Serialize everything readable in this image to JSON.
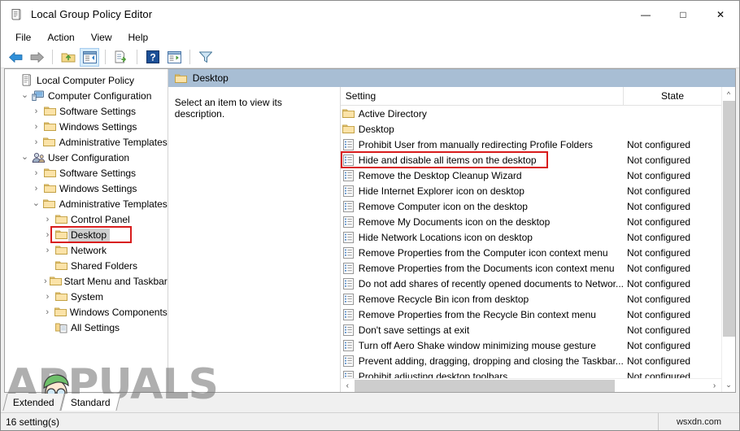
{
  "window": {
    "title": "Local Group Policy Editor",
    "icon": "policy-editor-icon",
    "minimize": "—",
    "maximize": "□",
    "close": "✕"
  },
  "menubar": {
    "items": [
      {
        "label": "File",
        "name": "menu-file"
      },
      {
        "label": "Action",
        "name": "menu-action"
      },
      {
        "label": "View",
        "name": "menu-view"
      },
      {
        "label": "Help",
        "name": "menu-help"
      }
    ]
  },
  "toolbar": {
    "buttons": [
      {
        "name": "back-icon"
      },
      {
        "name": "forward-icon"
      },
      {
        "name": "up-folder-icon"
      },
      {
        "name": "show-hide-console-tree-icon"
      },
      {
        "name": "export-list-icon"
      },
      {
        "name": "help-icon"
      },
      {
        "name": "show-hide-action-pane-icon"
      },
      {
        "name": "filter-icon"
      }
    ]
  },
  "tree": {
    "items": [
      {
        "label": "Local Computer Policy",
        "indent": 0,
        "twist": "",
        "icon": "policy-doc-icon",
        "selected": false
      },
      {
        "label": "Computer Configuration",
        "indent": 1,
        "twist": "⌄",
        "icon": "computer-icon",
        "selected": false
      },
      {
        "label": "Software Settings",
        "indent": 2,
        "twist": "›",
        "icon": "folder-icon",
        "selected": false
      },
      {
        "label": "Windows Settings",
        "indent": 2,
        "twist": "›",
        "icon": "folder-icon",
        "selected": false
      },
      {
        "label": "Administrative Templates",
        "indent": 2,
        "twist": "›",
        "icon": "folder-icon",
        "selected": false
      },
      {
        "label": "User Configuration",
        "indent": 1,
        "twist": "⌄",
        "icon": "user-icon",
        "selected": false
      },
      {
        "label": "Software Settings",
        "indent": 2,
        "twist": "›",
        "icon": "folder-icon",
        "selected": false
      },
      {
        "label": "Windows Settings",
        "indent": 2,
        "twist": "›",
        "icon": "folder-icon",
        "selected": false
      },
      {
        "label": "Administrative Templates",
        "indent": 2,
        "twist": "⌄",
        "icon": "folder-icon",
        "selected": false
      },
      {
        "label": "Control Panel",
        "indent": 3,
        "twist": "›",
        "icon": "folder-icon",
        "selected": false
      },
      {
        "label": "Desktop",
        "indent": 3,
        "twist": "›",
        "icon": "folder-icon",
        "selected": true
      },
      {
        "label": "Network",
        "indent": 3,
        "twist": "›",
        "icon": "folder-icon",
        "selected": false
      },
      {
        "label": "Shared Folders",
        "indent": 3,
        "twist": "",
        "icon": "folder-icon",
        "selected": false
      },
      {
        "label": "Start Menu and Taskbar",
        "indent": 3,
        "twist": "›",
        "icon": "folder-icon",
        "selected": false
      },
      {
        "label": "System",
        "indent": 3,
        "twist": "›",
        "icon": "folder-icon",
        "selected": false
      },
      {
        "label": "Windows Components",
        "indent": 3,
        "twist": "›",
        "icon": "folder-icon",
        "selected": false
      },
      {
        "label": "All Settings",
        "indent": 3,
        "twist": "",
        "icon": "all-settings-icon",
        "selected": false
      }
    ]
  },
  "rightpane": {
    "header_title": "Desktop",
    "header_icon": "folder-icon",
    "description": "Select an item to view its description.",
    "columns": {
      "setting": "Setting",
      "state": "State"
    },
    "rows": [
      {
        "name": "Active Directory",
        "state": "",
        "icon": "folder-icon",
        "highlighted": false
      },
      {
        "name": "Desktop",
        "state": "",
        "icon": "folder-icon",
        "highlighted": false
      },
      {
        "name": "Prohibit User from manually redirecting Profile Folders",
        "state": "Not configured",
        "icon": "policy-setting-icon",
        "highlighted": false
      },
      {
        "name": "Hide and disable all items on the desktop",
        "state": "Not configured",
        "icon": "policy-setting-icon",
        "highlighted": true
      },
      {
        "name": "Remove the Desktop Cleanup Wizard",
        "state": "Not configured",
        "icon": "policy-setting-icon",
        "highlighted": false
      },
      {
        "name": "Hide Internet Explorer icon on desktop",
        "state": "Not configured",
        "icon": "policy-setting-icon",
        "highlighted": false
      },
      {
        "name": "Remove Computer icon on the desktop",
        "state": "Not configured",
        "icon": "policy-setting-icon",
        "highlighted": false
      },
      {
        "name": "Remove My Documents icon on the desktop",
        "state": "Not configured",
        "icon": "policy-setting-icon",
        "highlighted": false
      },
      {
        "name": "Hide Network Locations icon on desktop",
        "state": "Not configured",
        "icon": "policy-setting-icon",
        "highlighted": false
      },
      {
        "name": "Remove Properties from the Computer icon context menu",
        "state": "Not configured",
        "icon": "policy-setting-icon",
        "highlighted": false
      },
      {
        "name": "Remove Properties from the Documents icon context menu",
        "state": "Not configured",
        "icon": "policy-setting-icon",
        "highlighted": false
      },
      {
        "name": "Do not add shares of recently opened documents to Networ...",
        "state": "Not configured",
        "icon": "policy-setting-icon",
        "highlighted": false
      },
      {
        "name": "Remove Recycle Bin icon from desktop",
        "state": "Not configured",
        "icon": "policy-setting-icon",
        "highlighted": false
      },
      {
        "name": "Remove Properties from the Recycle Bin context menu",
        "state": "Not configured",
        "icon": "policy-setting-icon",
        "highlighted": false
      },
      {
        "name": "Don't save settings at exit",
        "state": "Not configured",
        "icon": "policy-setting-icon",
        "highlighted": false
      },
      {
        "name": "Turn off Aero Shake window minimizing mouse gesture",
        "state": "Not configured",
        "icon": "policy-setting-icon",
        "highlighted": false
      },
      {
        "name": "Prevent adding, dragging, dropping and closing the Taskbar...",
        "state": "Not configured",
        "icon": "policy-setting-icon",
        "highlighted": false
      },
      {
        "name": "Prohibit adjusting desktop toolbars",
        "state": "Not configured",
        "icon": "policy-setting-icon",
        "highlighted": false
      }
    ]
  },
  "tabs": [
    {
      "label": "Extended",
      "active": false,
      "name": "tab-extended"
    },
    {
      "label": "Standard",
      "active": true,
      "name": "tab-standard"
    }
  ],
  "statusbar": {
    "left": "16 setting(s)",
    "right": "wsxdn.com"
  },
  "watermark": {
    "text": "APPUALS"
  },
  "colors": {
    "header_blue": "#a8bed4",
    "highlight_red": "#d81c1c",
    "selection_gray": "#cfcfcf"
  }
}
